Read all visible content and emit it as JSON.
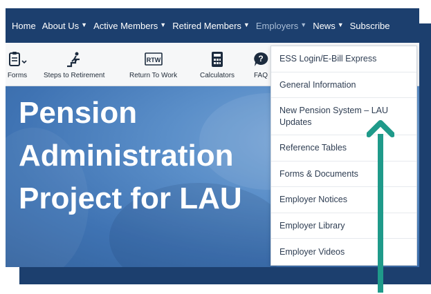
{
  "nav": {
    "items": [
      {
        "label": "Home",
        "chevron": false,
        "active": false
      },
      {
        "label": "About Us",
        "chevron": true,
        "active": false
      },
      {
        "label": "Active Members",
        "chevron": true,
        "active": false
      },
      {
        "label": "Retired Members",
        "chevron": true,
        "active": false
      },
      {
        "label": "Employers",
        "chevron": true,
        "active": true
      },
      {
        "label": "News",
        "chevron": true,
        "active": false
      },
      {
        "label": "Subscribe",
        "chevron": false,
        "active": false
      }
    ]
  },
  "toolbar": {
    "forms": "Forms",
    "steps": "Steps to Retirement",
    "rtw_icon_text": "RTW",
    "rtw": "Return To Work",
    "calculators": "Calculators",
    "faq": "FAQ"
  },
  "hero": {
    "line1": "Pension",
    "line2": "Administration",
    "line3": "Project for LAU"
  },
  "dropdown": {
    "items": [
      "ESS Login/E-Bill Express",
      "General Information",
      "New Pension System – LAU Updates",
      "Reference Tables",
      "Forms & Documents",
      "Employer Notices",
      "Employer Library",
      "Employer Videos"
    ]
  },
  "colors": {
    "navy": "#1c3f6e",
    "arrow": "#1f9a8a",
    "hero_blue": "#4a7fbf"
  }
}
